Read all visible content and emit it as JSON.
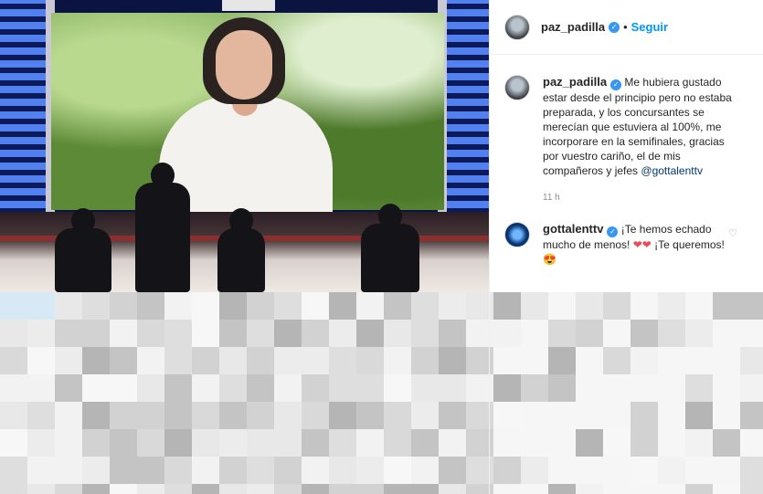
{
  "post": {
    "author": "paz_padilla",
    "follow_label": "Seguir",
    "dot": "•",
    "verified_glyph": "✓"
  },
  "caption": {
    "user": "paz_padilla",
    "text": "Me hubiera gustado estar desde el principio pero no estaba preparada, y los concursantes se merecían que estuviera al 100%, me incorporare en la semifinales, gracias por vuestro cariño, el de mis compañeros y jefes ",
    "mention": "@gottalenttv",
    "time": "11 h"
  },
  "reply": {
    "user": "gottalenttv",
    "text_before": "¡Te hemos echado mucho de menos! ",
    "hearts": "❤❤",
    "text_after": "¡Te queremos! 😍"
  },
  "icons": {
    "heart_outline": "♡"
  },
  "colors": {
    "accent": "#0095f6",
    "verified": "#3897f0",
    "heart": "#ed4956"
  }
}
